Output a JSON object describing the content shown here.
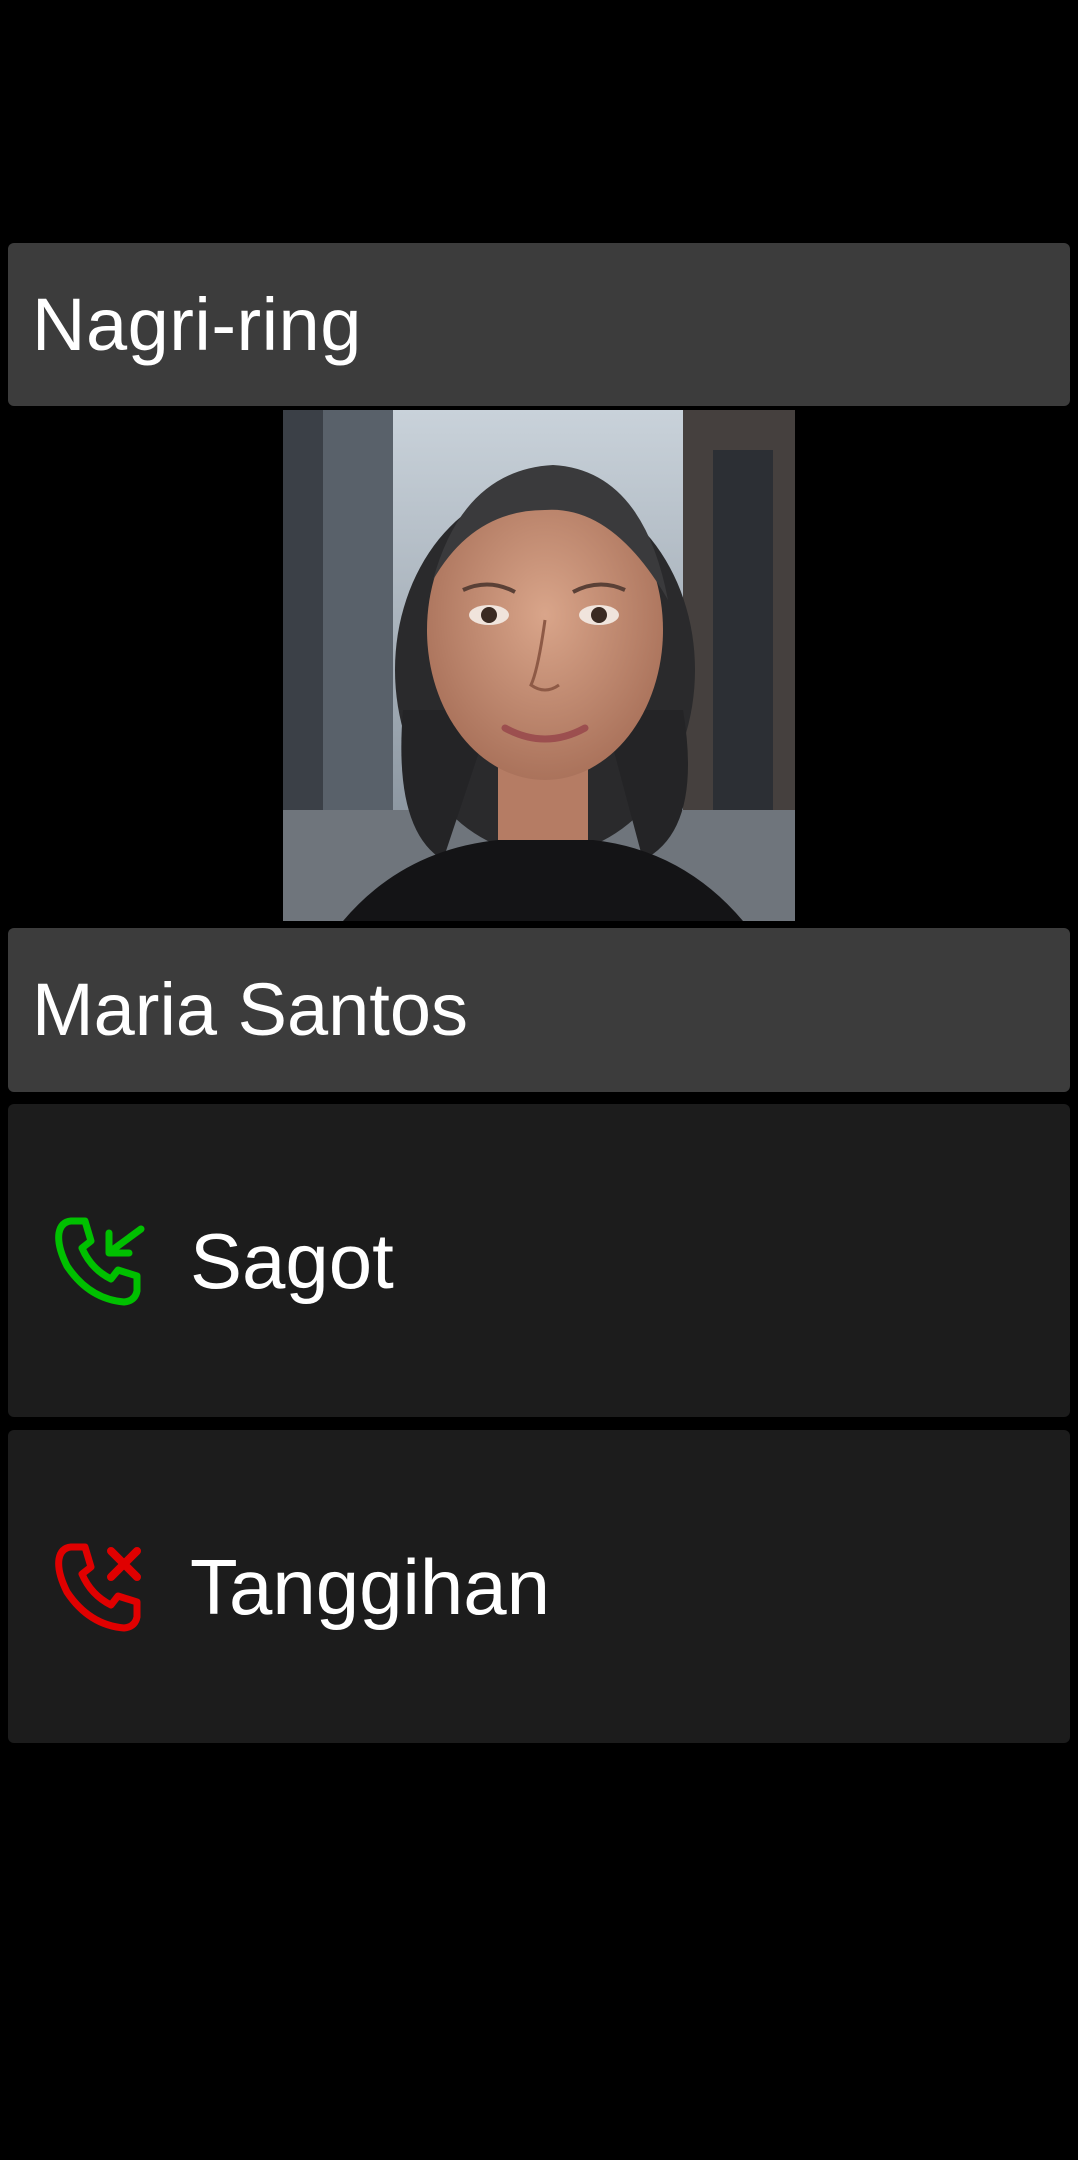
{
  "call": {
    "status": "Nagri-ring",
    "caller_name": "Maria Santos"
  },
  "actions": {
    "answer": {
      "label": "Sagot",
      "icon": "incoming-call-icon",
      "color": "#00c000"
    },
    "decline": {
      "label": "Tanggihan",
      "icon": "call-reject-icon",
      "color": "#e00000"
    }
  },
  "colors": {
    "background": "#000000",
    "panel": "#3c3c3c",
    "button": "#1c1c1c",
    "text": "#ffffff"
  }
}
